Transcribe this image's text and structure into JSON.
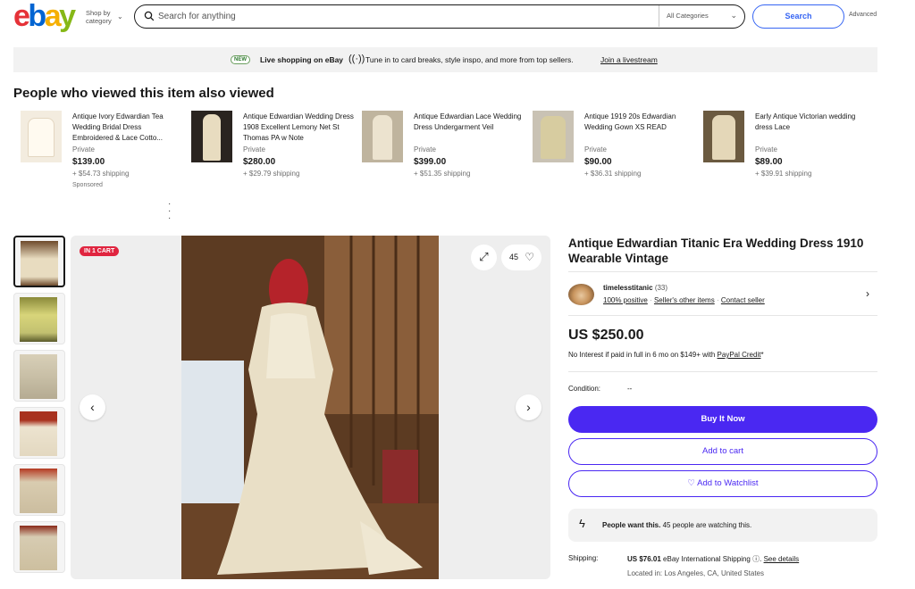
{
  "header": {
    "logo": {
      "e": "e",
      "b": "b",
      "a": "a",
      "y": "y"
    },
    "shop_by": "Shop by",
    "category": "category",
    "search_placeholder": "Search for anything",
    "category_select": "All Categories",
    "search_button": "Search",
    "advanced": "Advanced"
  },
  "live_banner": {
    "badge": "NEW",
    "title": "Live shopping on eBay",
    "description": "Tune in to card breaks, style inspo, and more from top sellers.",
    "link": "Join a livestream"
  },
  "also_viewed": {
    "heading": "People who viewed this item also viewed",
    "items": [
      {
        "title": "Antique Ivory Edwardian Tea Wedding Bridal Dress Embroidered & Lace Cotto...",
        "seller": "Private",
        "price": "$139.00",
        "shipping": "+ $54.73 shipping",
        "sponsored": "Sponsored"
      },
      {
        "title": "Antique Edwardian Wedding Dress 1908 Excellent Lemony Net St Thomas PA w Note",
        "seller": "Private",
        "price": "$280.00",
        "shipping": "+ $29.79 shipping"
      },
      {
        "title": "Antique Edwardian Lace Wedding Dress Undergarment Veil",
        "seller": "Private",
        "price": "$399.00",
        "shipping": "+ $51.35 shipping"
      },
      {
        "title": "Antique 1919 20s Edwardian Wedding Gown XS READ",
        "seller": "Private",
        "price": "$90.00",
        "shipping": "+ $36.31 shipping"
      },
      {
        "title": "Early Antique Victorian wedding dress Lace",
        "seller": "Private",
        "price": "$89.00",
        "shipping": "+ $39.91 shipping"
      }
    ]
  },
  "gallery": {
    "badge": "IN 1 CART",
    "watch_count": "45"
  },
  "item": {
    "title": "Antique Edwardian Titanic Era Wedding Dress 1910 Wearable Vintage",
    "seller_name": "timelesstitanic",
    "seller_feedback_count": "(33)",
    "positive": "100% positive",
    "other_items": "Seller's other items",
    "contact": "Contact seller",
    "price": "US $250.00",
    "finance_text": "No Interest if paid in full in 6 mo on $149+ with ",
    "finance_link": "PayPal Credit",
    "finance_mark": "*",
    "condition_label": "Condition:",
    "condition_value": "--",
    "buy_now": "Buy It Now",
    "add_to_cart": "Add to cart",
    "add_to_watchlist": "Add to Watchlist",
    "people_want_bold": "People want this.",
    "people_want_text": " 45 people are watching this.",
    "shipping_label": "Shipping:",
    "shipping_price": "US $76.01",
    "shipping_method": " eBay International Shipping ",
    "see_details": "See details",
    "location": "Located in: Los Angeles, CA, United States"
  },
  "colors": {
    "primary": "#4a28f2",
    "badge_red": "#e0243f",
    "link_blue": "#3665f3"
  }
}
